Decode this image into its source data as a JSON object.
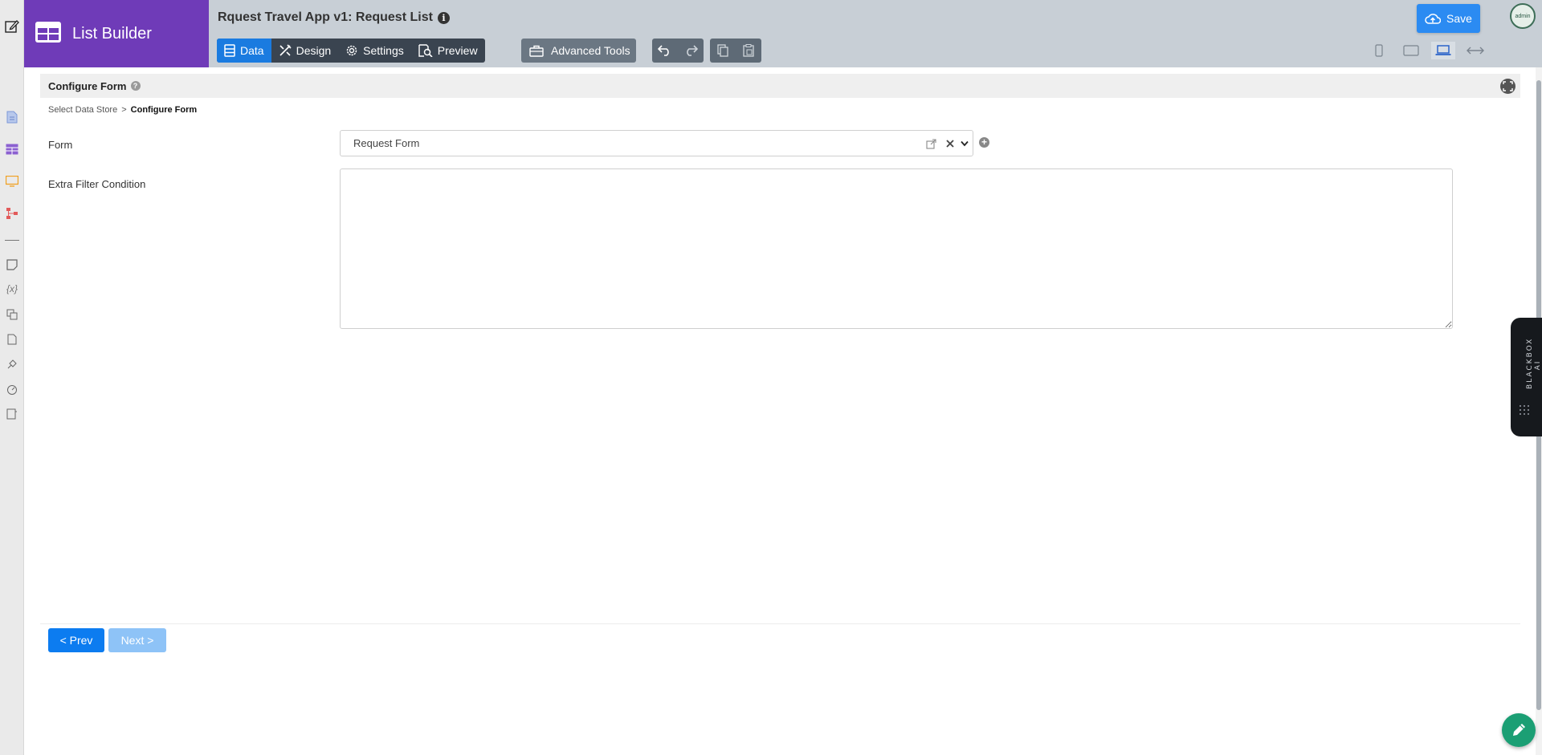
{
  "colors": {
    "brand": "#6f3bb8",
    "header_bg": "#c8cfd6",
    "tab_active": "#1a7be0",
    "primary_button": "#0c7cf0",
    "save_button": "#2b8bf2",
    "fab": "#1b9f74"
  },
  "brand": {
    "title": "List Builder",
    "icon": "table-grid-icon"
  },
  "header": {
    "app_title": "Rquest Travel App v1: Request List",
    "info_icon": "info-icon",
    "tabs": [
      {
        "label": "Data",
        "icon": "list-icon",
        "active": true
      },
      {
        "label": "Design",
        "icon": "tools-icon",
        "active": false
      },
      {
        "label": "Settings",
        "icon": "gear-icon",
        "active": false
      },
      {
        "label": "Preview",
        "icon": "search-doc-icon",
        "active": false
      }
    ],
    "advanced_tools_label": "Advanced Tools",
    "toolbar_icons": [
      "undo-icon",
      "redo-icon",
      "copy-icon",
      "paste-icon"
    ],
    "device_icons": [
      "phone-icon",
      "tablet-icon",
      "laptop-icon",
      "fullwidth-icon"
    ],
    "active_device": "laptop-icon",
    "save_label": "Save",
    "avatar_text": "admin"
  },
  "section": {
    "title": "Configure Form"
  },
  "breadcrumb": {
    "items": [
      "Select Data Store",
      "Configure Form"
    ],
    "separator": ">"
  },
  "form": {
    "form_label": "Form",
    "form_value": "Request Form",
    "filter_label": "Extra Filter Condition",
    "filter_value": ""
  },
  "nav": {
    "prev_label": "< Prev",
    "next_label": "Next >"
  },
  "ai_panel": {
    "label": "BLACKBOX AI"
  }
}
